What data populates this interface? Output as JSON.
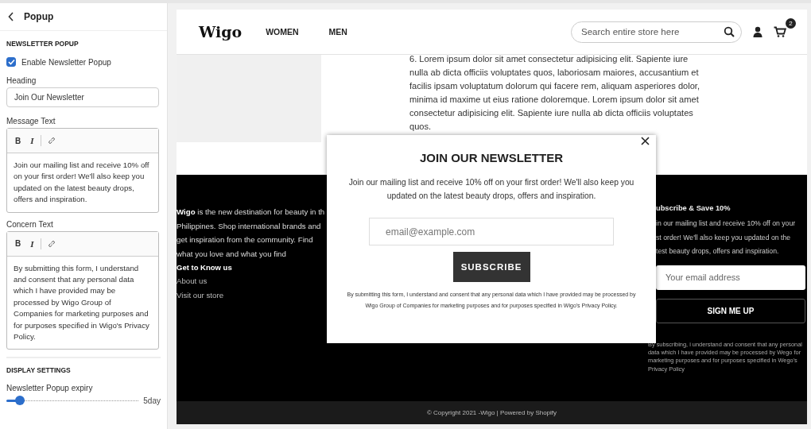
{
  "sidebar": {
    "title": "Popup",
    "newsletter_section": "NEWSLETTER POPUP",
    "enable": {
      "label": "Enable Newsletter Popup",
      "checked": true
    },
    "heading": {
      "label": "Heading",
      "value": "Join Our Newsletter"
    },
    "editors": [
      {
        "label": "Message Text",
        "tools": [
          "B",
          "I"
        ],
        "text": "Join our mailing list and receive 10% off on your first order! We'll also keep you updated on the latest beauty drops, offers and inspiration."
      },
      {
        "label": "Concern Text",
        "tools": [
          "B",
          "I"
        ],
        "text": "By submitting this form, I understand and consent that any personal data which I have provided may be processed by Wigo Group of Companies for marketing purposes and for purposes specified in Wigo's Privacy Policy."
      }
    ],
    "display_section": "DISPLAY SETTINGS",
    "expiry": {
      "label": "Newsletter Popup expiry",
      "level": 0.1,
      "reading": "5day"
    }
  },
  "store": {
    "logo": "Wigo",
    "nav": [
      "WOMEN",
      "MEN"
    ],
    "search": {
      "placeholder": "Search entire store here"
    },
    "cart_count": "2",
    "body_text": "6. Lorem ipsum dolor sit amet consectetur adipisicing elit. Sapiente iure nulla ab dicta officiis voluptates quos, laboriosam maiores, accusantium et facilis ipsam voluptatum dolorum qui facere rem, aliquam asperiores dolor, minima id maxime ut eius ratione doloremque. Lorem ipsum dolor sit amet consectetur adipisicing elit. Sapiente iure nulla ab dicta officiis voluptates quos.",
    "footer": {
      "about_lines": [
        "**Wigo** is the new destination for beauty in th",
        "Philippines. Shop international brands and",
        "get inspiration from the community. Find",
        "what you love and what you find"
      ],
      "links_heading": "Get to Know us",
      "links": [
        "About us",
        "Visit our store"
      ],
      "subscribe_heading": "ubscribe & Save 10%",
      "subscribe_lines": [
        "in our mailing list and receive 10% off on your",
        "st order! We'll also keep you updated on the",
        "test beauty drops, offers and inspiration."
      ],
      "email_placeholder": "Your email address",
      "button": "SIGN ME UP",
      "legal": "By subscribing, i understand and consent that any personal data which I have provided may be processed by Wego for marketing purposes and for purposes specified in Wego's Privacy Policy"
    },
    "copyright": "© Copyright 2021 -Wigo | Powered by Shopify"
  },
  "popup": {
    "title": "JOIN OUR NEWSLETTER",
    "message": "Join our mailing list and receive 10% off on your first order! We'll also keep you updated on the latest beauty drops, offers and inspiration.",
    "email_placeholder": "email@example.com",
    "button": "SUBSCRIBE",
    "legal": "By submitting this form, I understand and consent that any personal data which I have provided may be processed by Wigo Group of Companies for marketing purposes and for purposes specified in Wigo's Privacy Policy."
  }
}
